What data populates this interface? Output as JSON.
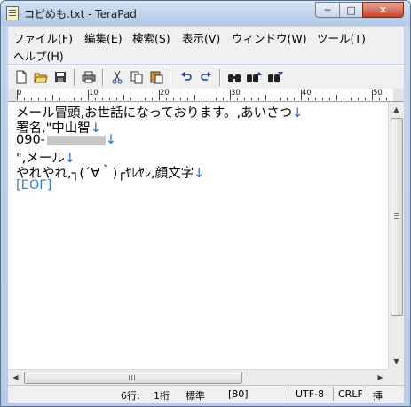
{
  "window": {
    "title": "コピめも.txt - TeraPad"
  },
  "title_buttons": {
    "minimize": "─",
    "maximize": "□",
    "close": "✕"
  },
  "menu": {
    "items": [
      {
        "label": "ファイル(F)"
      },
      {
        "label": "編集(E)"
      },
      {
        "label": "検索(S)"
      },
      {
        "label": "表示(V)"
      },
      {
        "label": "ウィンドウ(W)"
      },
      {
        "label": "ツール(T)"
      },
      {
        "label": "ヘルプ(H)"
      }
    ]
  },
  "toolbar": {
    "buttons": [
      {
        "icon": "new-file-icon"
      },
      {
        "icon": "open-folder-icon"
      },
      {
        "icon": "save-icon"
      },
      {
        "icon": "print-icon"
      },
      {
        "icon": "cut-icon"
      },
      {
        "icon": "copy-icon"
      },
      {
        "icon": "paste-icon"
      },
      {
        "icon": "undo-icon"
      },
      {
        "icon": "redo-icon"
      },
      {
        "icon": "find-icon"
      },
      {
        "icon": "find-previous-icon"
      },
      {
        "icon": "find-next-icon"
      }
    ]
  },
  "ruler": {
    "labels": [
      "0",
      "10",
      "20",
      "30",
      "40",
      "50"
    ]
  },
  "editor": {
    "lines": [
      "メール冒頭,お世話になっております。,あいさつ",
      "署名,\"中山智",
      "090-",
      "\",メール",
      "やれやれ,┐(´∀｀)┌ﾔﾚﾔﾚ,顔文字"
    ],
    "eol_mark": "↓",
    "eof_mark": "[EOF]"
  },
  "status": {
    "line": "6行:",
    "column": "1桁",
    "mode": "標準",
    "code": "[80]",
    "encoding": "UTF-8",
    "newline": "CRLF",
    "insert": "挿"
  },
  "colors": {
    "eol": "#1d6bd1",
    "eof": "#3a7fb8",
    "close_button": "#c7422c"
  }
}
